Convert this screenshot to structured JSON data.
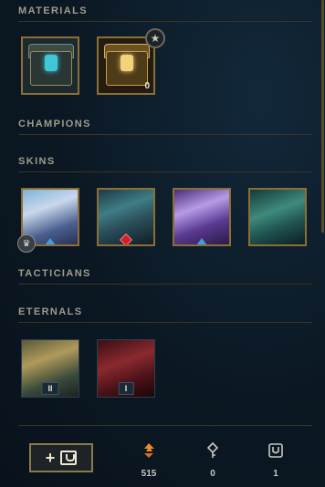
{
  "sections": {
    "materials": "MATERIALS",
    "champions": "CHAMPIONS",
    "skins": "SKINS",
    "tacticians": "TACTICIANS",
    "eternals": "ETERNALS"
  },
  "materials": [
    {
      "name": "hextech-chest",
      "count": ""
    },
    {
      "name": "masterwork-chest",
      "count": "0"
    }
  ],
  "skins": [
    {
      "rarity": "epic",
      "badge": "emblem"
    },
    {
      "rarity": "mythic",
      "badge": ""
    },
    {
      "rarity": "epic",
      "badge": ""
    },
    {
      "rarity": "",
      "badge": ""
    }
  ],
  "eternals": [
    {
      "series": "II"
    },
    {
      "series": "I"
    }
  ],
  "currencies": [
    {
      "icon": "orange-essence-icon",
      "value": "515"
    },
    {
      "icon": "key-fragment-icon",
      "value": "0"
    },
    {
      "icon": "chest-icon",
      "value": "1"
    }
  ],
  "colors": {
    "accent_gold": "#c8aa6e",
    "orange_essence": "#f08a24"
  }
}
